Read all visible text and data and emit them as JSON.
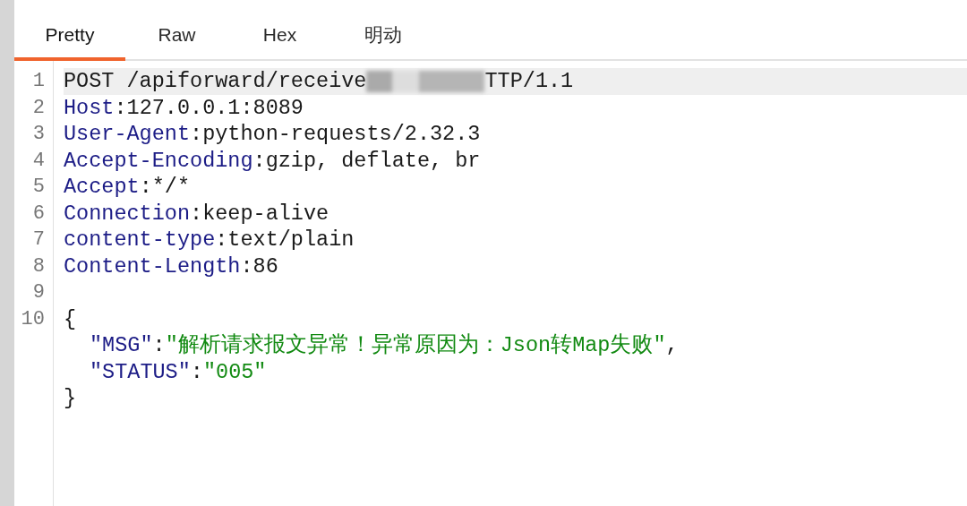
{
  "tabs": [
    {
      "label": "Pretty",
      "selected": true
    },
    {
      "label": "Raw",
      "selected": false
    },
    {
      "label": "Hex",
      "selected": false
    },
    {
      "label": "明动",
      "selected": false
    }
  ],
  "lines": [
    {
      "number": "1",
      "kind": "request-line",
      "selected": true,
      "before": "POST /apiforward/receive",
      "after": "TTP/1.1"
    },
    {
      "number": "2",
      "kind": "header",
      "selected": false,
      "name": "Host",
      "separator": ":",
      "value": "127.0.0.1:8089"
    },
    {
      "number": "3",
      "kind": "header",
      "selected": false,
      "name": "User-Agent",
      "separator": ":",
      "value": "python-requests/2.32.3"
    },
    {
      "number": "4",
      "kind": "header",
      "selected": false,
      "name": "Accept-Encoding",
      "separator": ":",
      "value": "gzip, deflate, br"
    },
    {
      "number": "5",
      "kind": "header",
      "selected": false,
      "name": "Accept",
      "separator": ":",
      "value": "*/*"
    },
    {
      "number": "6",
      "kind": "header",
      "selected": false,
      "name": "Connection",
      "separator": ":",
      "value": "keep-alive"
    },
    {
      "number": "7",
      "kind": "header",
      "selected": false,
      "name": "content-type",
      "separator": ":",
      "value": "text/plain"
    },
    {
      "number": "8",
      "kind": "header",
      "selected": false,
      "name": "Content-Length",
      "separator": ":",
      "value": "86"
    },
    {
      "number": "9",
      "kind": "blank",
      "selected": false
    },
    {
      "number": "10",
      "kind": "body",
      "selected": false,
      "body": [
        {
          "indent": false,
          "parts": [
            {
              "kind": "punct",
              "text": "{"
            }
          ]
        },
        {
          "indent": true,
          "parts": [
            {
              "kind": "key",
              "text": "\"MSG\""
            },
            {
              "kind": "punct",
              "text": ":"
            },
            {
              "kind": "string",
              "text": "\"解析请求报文异常！异常原因为：Json转Map失败\""
            },
            {
              "kind": "punct",
              "text": ","
            }
          ]
        },
        {
          "indent": true,
          "parts": [
            {
              "kind": "key",
              "text": "\"STATUS\""
            },
            {
              "kind": "punct",
              "text": ":"
            },
            {
              "kind": "string",
              "text": "\"005\""
            }
          ]
        },
        {
          "indent": false,
          "parts": [
            {
              "kind": "punct",
              "text": "}"
            }
          ]
        }
      ]
    }
  ]
}
